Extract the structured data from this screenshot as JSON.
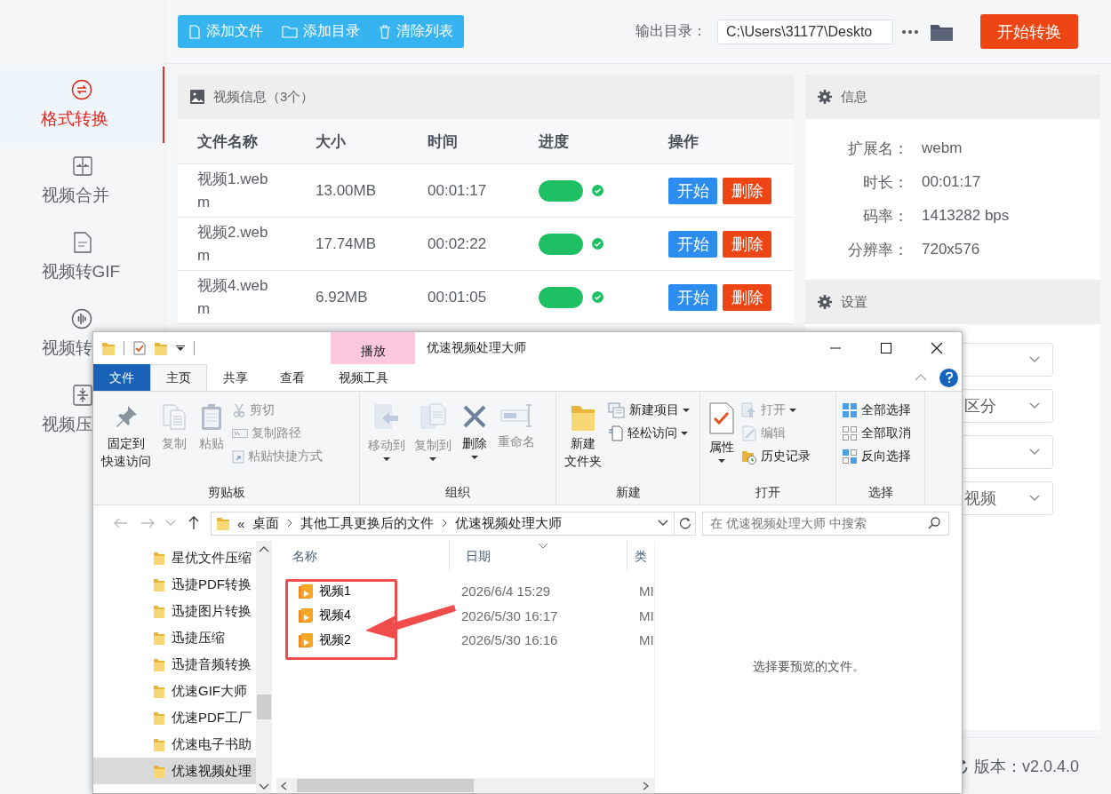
{
  "sidebar": {
    "items": [
      {
        "label": "格式转换",
        "selected": true
      },
      {
        "label": "视频合并",
        "selected": false
      },
      {
        "label": "视频转GIF",
        "selected": false
      },
      {
        "label": "视频转",
        "selected": false
      },
      {
        "label": "视频压",
        "selected": false
      }
    ]
  },
  "toolbar": {
    "buttons": [
      "添加文件",
      "添加目录",
      "清除列表"
    ],
    "output_label": "输出目录：",
    "output_path": "C:\\Users\\31177\\Deskto",
    "start_button": "开始转换"
  },
  "file_panel": {
    "title": "视频信息（3个）",
    "columns": [
      "文件名称",
      "大小",
      "时间",
      "进度",
      "操作"
    ],
    "rows": [
      {
        "name": "视频1.webm",
        "size": "13.00MB",
        "time": "00:01:17",
        "level": 1,
        "actions": [
          "开始",
          "删除"
        ]
      },
      {
        "name": "视频2.webm",
        "size": "17.74MB",
        "time": "00:02:22",
        "level": 1,
        "actions": [
          "开始",
          "删除"
        ]
      },
      {
        "name": "视频4.webm",
        "size": "6.92MB",
        "time": "00:01:05",
        "level": 1,
        "actions": [
          "开始",
          "删除"
        ]
      }
    ]
  },
  "info_panel": {
    "title": "信息",
    "fields": [
      {
        "label": "扩展名：",
        "value": "webm"
      },
      {
        "label": "时长：",
        "value": "00:01:17"
      },
      {
        "label": "码率：",
        "value": "1413282 bps"
      },
      {
        "label": "分辨率：",
        "value": "720x576"
      }
    ]
  },
  "settings_panel": {
    "title": "设置",
    "selects": [
      {
        "kind": "dropdown"
      },
      {
        "kind": "dropdown",
        "value": "区分"
      },
      {
        "kind": "dropdown"
      },
      {
        "kind": "dropdown",
        "value": "视频"
      }
    ]
  },
  "version": "版本：v2.0.4.0",
  "explorer": {
    "title": "优速视频处理大师",
    "context_group": "播放",
    "tabs": [
      {
        "label": "文件",
        "kind": "file",
        "selected": false
      },
      {
        "label": "主页",
        "kind": "tab",
        "selected": true
      },
      {
        "label": "共享",
        "kind": "tab",
        "selected": false
      },
      {
        "label": "查看",
        "kind": "tab",
        "selected": false
      },
      {
        "label": "视频工具",
        "kind": "context",
        "selected": false
      }
    ],
    "ribbon": [
      {
        "label": "剪贴板",
        "commands": [
          {
            "lines": [
              "固定到",
              "快速访问"
            ],
            "kind": "large",
            "disabled": false,
            "dropdown": false
          },
          {
            "label": "复制",
            "kind": "large",
            "disabled": true,
            "dropdown": false
          },
          {
            "label": "粘贴",
            "kind": "large",
            "disabled": true,
            "dropdown": false
          },
          {
            "label": "剪切",
            "kind": "small",
            "disabled": true,
            "dropdown": false
          },
          {
            "label": "复制路径",
            "kind": "small",
            "disabled": true,
            "dropdown": false
          },
          {
            "label": "粘贴快捷方式",
            "kind": "small",
            "disabled": true,
            "dropdown": false
          }
        ]
      },
      {
        "label": "组织",
        "commands": [
          {
            "label": "移动到",
            "kind": "large",
            "disabled": true,
            "dropdown": true
          },
          {
            "label": "复制到",
            "kind": "large",
            "disabled": true,
            "dropdown": true
          },
          {
            "label": "删除",
            "kind": "large",
            "disabled": false,
            "dropdown": true
          },
          {
            "label": "重命名",
            "kind": "large",
            "disabled": true,
            "dropdown": false
          }
        ]
      },
      {
        "label": "新建",
        "commands": [
          {
            "lines": [
              "新建",
              "文件夹"
            ],
            "kind": "large",
            "disabled": false,
            "dropdown": false
          },
          {
            "label": "新建项目",
            "kind": "small",
            "disabled": false,
            "dropdown": true
          },
          {
            "label": "轻松访问",
            "kind": "small",
            "disabled": false,
            "dropdown": true
          }
        ]
      },
      {
        "label": "打开",
        "commands": [
          {
            "label": "属性",
            "kind": "large",
            "disabled": false,
            "dropdown": true
          },
          {
            "label": "打开",
            "kind": "small",
            "disabled": true,
            "dropdown": true
          },
          {
            "label": "编辑",
            "kind": "small",
            "disabled": true,
            "dropdown": false
          },
          {
            "label": "历史记录",
            "kind": "small",
            "disabled": false,
            "dropdown": false
          }
        ]
      },
      {
        "label": "选择",
        "commands": [
          {
            "label": "全部选择",
            "kind": "small",
            "disabled": false,
            "dropdown": false
          },
          {
            "label": "全部取消",
            "kind": "small",
            "disabled": false,
            "dropdown": false
          },
          {
            "label": "反向选择",
            "kind": "small",
            "disabled": false,
            "dropdown": false
          }
        ]
      }
    ],
    "address": {
      "overflow": "«",
      "segments": [
        "桌面",
        "其他工具更换后的文件",
        "优速视频处理大师"
      ]
    },
    "search": {
      "placeholder": "在 优速视频处理大师 中搜索"
    },
    "nav_items": [
      {
        "label": "星优文件压缩",
        "selected": false
      },
      {
        "label": "迅捷PDF转换",
        "selected": false
      },
      {
        "label": "迅捷图片转换",
        "selected": false
      },
      {
        "label": "迅捷压缩",
        "selected": false
      },
      {
        "label": "迅捷音频转换",
        "selected": false
      },
      {
        "label": "优速GIF大师",
        "selected": false
      },
      {
        "label": "优速PDF工厂",
        "selected": false
      },
      {
        "label": "优速电子书助",
        "selected": false
      },
      {
        "label": "优速视频处理",
        "selected": true
      }
    ],
    "columns": [
      "名称",
      "日期",
      "类"
    ],
    "files": [
      {
        "name": "视频1",
        "date": "2026/6/4 15:29",
        "type": "MI"
      },
      {
        "name": "视频4",
        "date": "2026/5/30 16:17",
        "type": "MI"
      },
      {
        "name": "视频2",
        "date": "2026/5/30 16:16",
        "type": "MI"
      }
    ],
    "preview": "选择要预览的文件。"
  }
}
